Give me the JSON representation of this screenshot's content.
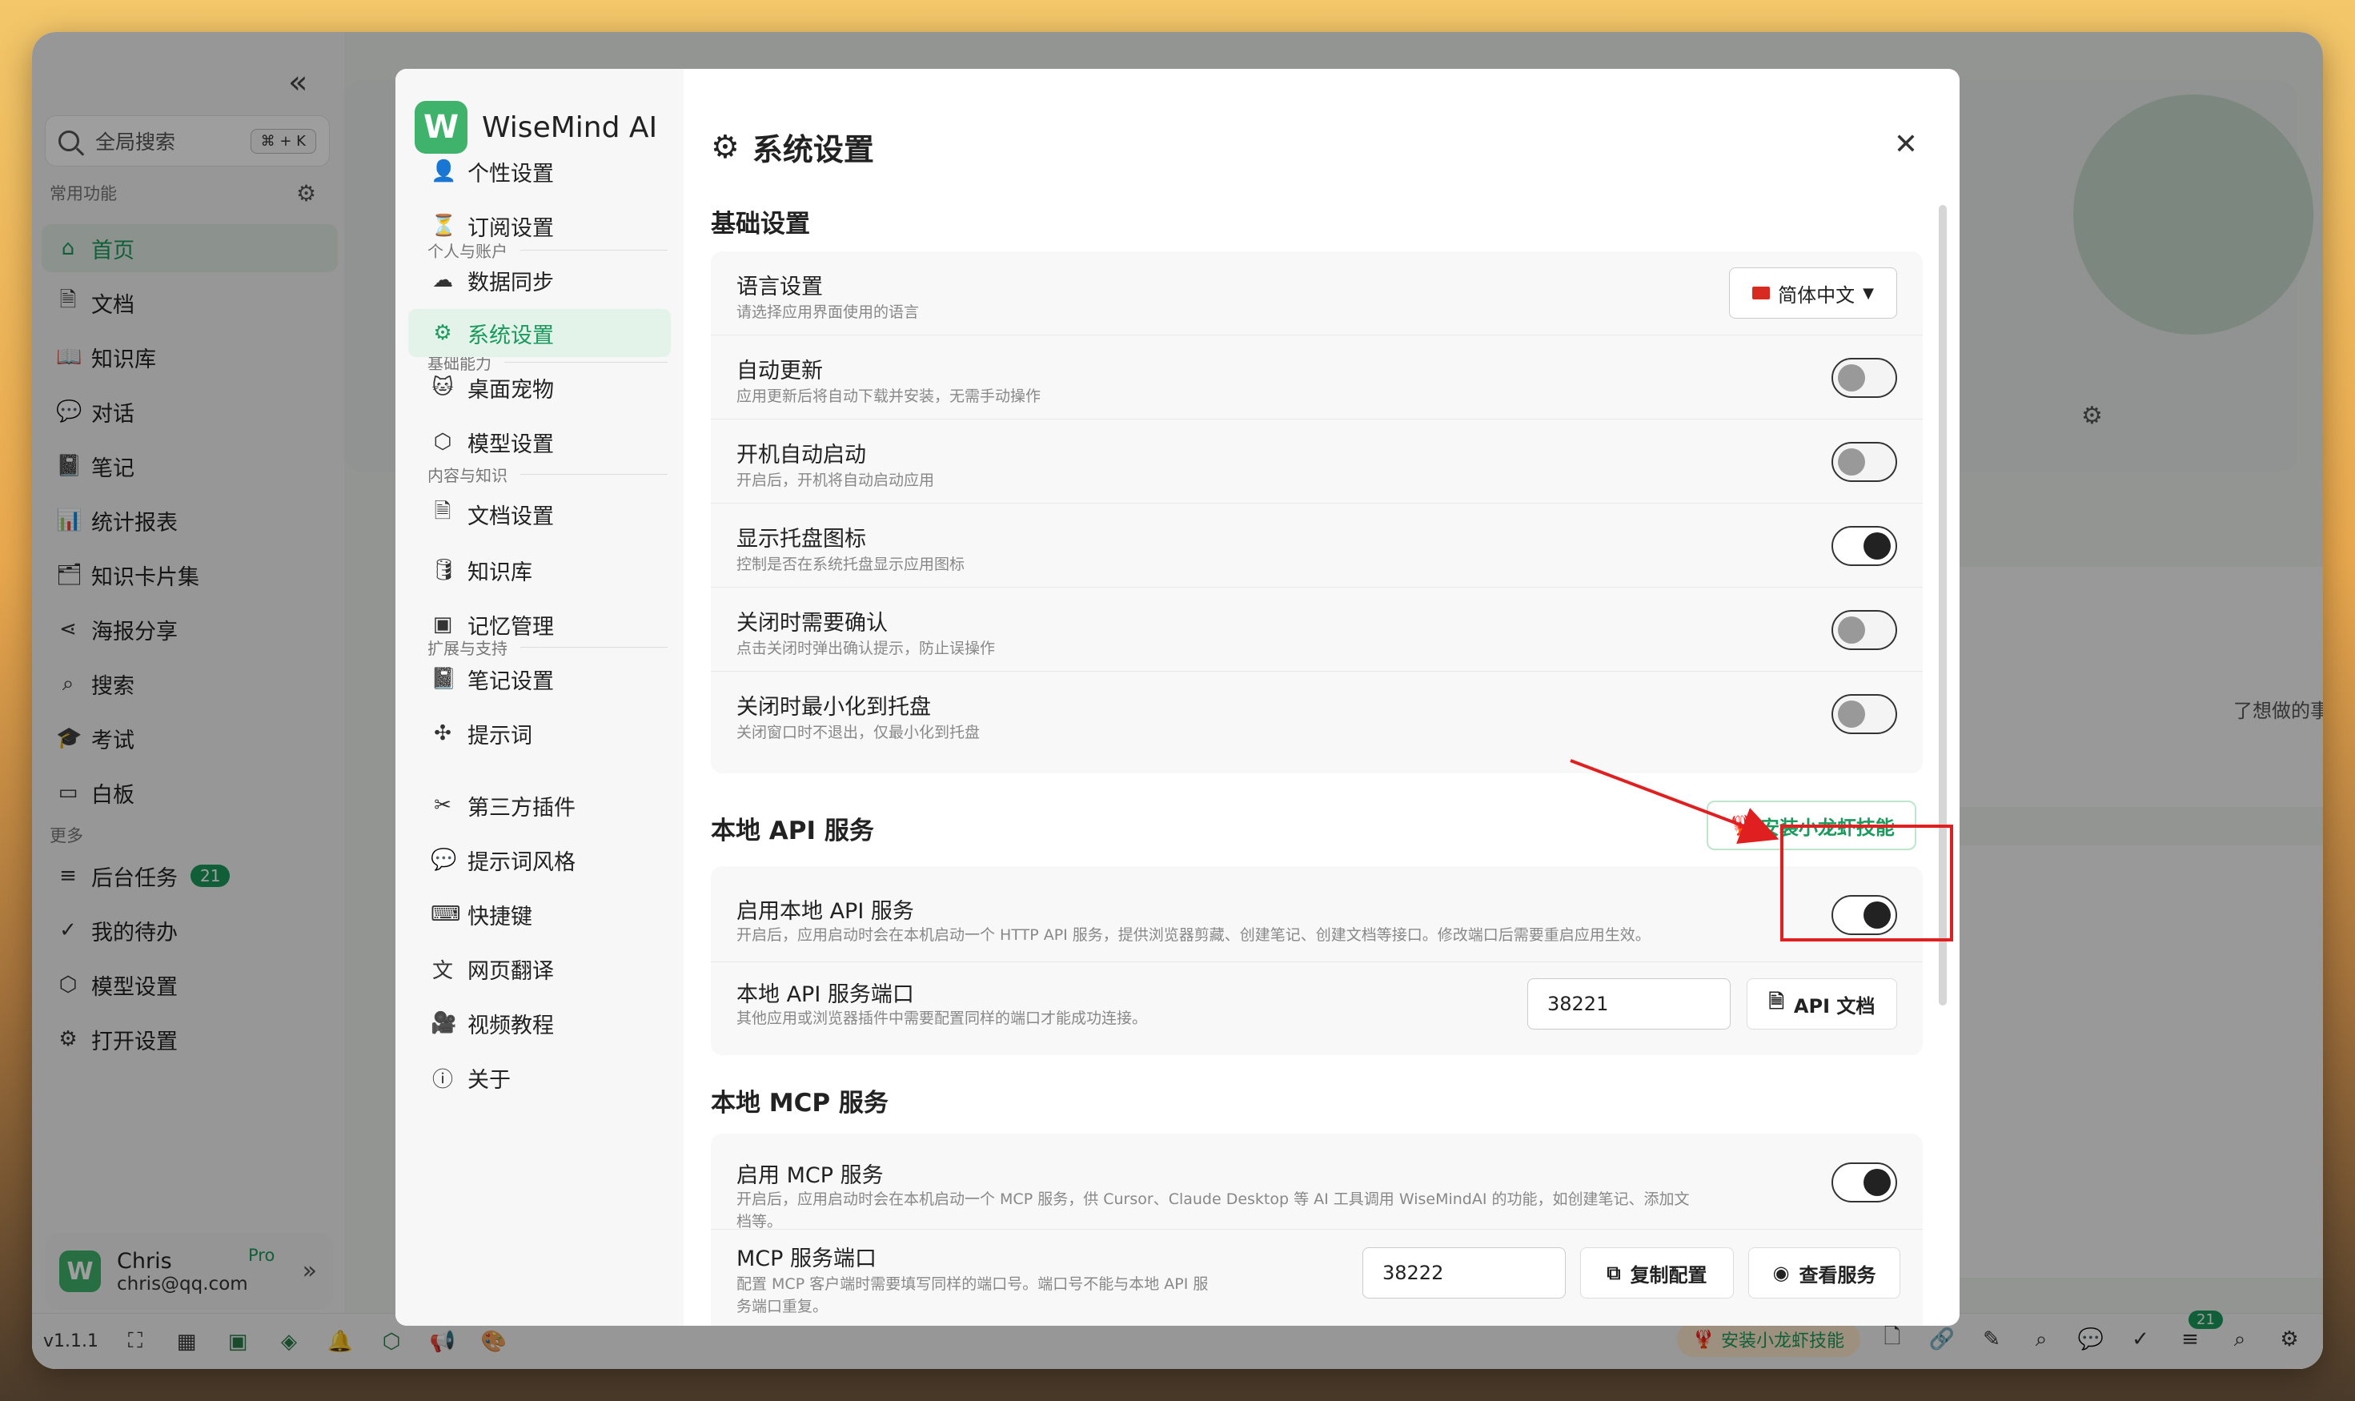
{
  "sidebar": {
    "search_placeholder": "全局搜索",
    "search_shortcut": "⌘ + K",
    "section_common": "常用功能",
    "section_more": "更多",
    "items": [
      {
        "label": "首页",
        "icon": "home-icon",
        "glyph": "⌂"
      },
      {
        "label": "文档",
        "icon": "document-icon",
        "glyph": "🗎"
      },
      {
        "label": "知识库",
        "icon": "book-icon",
        "glyph": "📖"
      },
      {
        "label": "对话",
        "icon": "chat-icon",
        "glyph": "💬"
      },
      {
        "label": "笔记",
        "icon": "notebook-icon",
        "glyph": "📓"
      },
      {
        "label": "统计报表",
        "icon": "chart-icon",
        "glyph": "📊"
      },
      {
        "label": "知识卡片集",
        "icon": "card-icon",
        "glyph": "🗂"
      },
      {
        "label": "海报分享",
        "icon": "share-icon",
        "glyph": "⋖"
      },
      {
        "label": "搜索",
        "icon": "search-icon",
        "glyph": "⌕"
      },
      {
        "label": "考试",
        "icon": "graduation-icon",
        "glyph": "🎓"
      },
      {
        "label": "白板",
        "icon": "whiteboard-icon",
        "glyph": "▭"
      }
    ],
    "more_items": [
      {
        "label": "后台任务",
        "icon": "list-icon",
        "glyph": "≡",
        "badge": "21"
      },
      {
        "label": "我的待办",
        "icon": "check-circle-icon",
        "glyph": "✓"
      },
      {
        "label": "模型设置",
        "icon": "cube-icon",
        "glyph": "⬡"
      },
      {
        "label": "打开设置",
        "icon": "gear-icon",
        "glyph": "⚙"
      }
    ],
    "user": {
      "name": "Chris",
      "email": "chris@qq.com",
      "plan": "Pro",
      "avatar": "W"
    }
  },
  "bottombar": {
    "version": "v1.1.1",
    "install_label": "安装小龙虾技能",
    "task_badge": "21"
  },
  "bg": {
    "text_fragment": "了想做的事，再扩"
  },
  "modal": {
    "logo_letter": "W",
    "app_name": "WiseMind AI",
    "title": "系统设置",
    "groups": [
      "个人与账户",
      "基础能力",
      "内容与知识",
      "扩展与支持"
    ],
    "nav": [
      {
        "label": "个性设置",
        "glyph": "👤",
        "icon": "user-icon"
      },
      {
        "label": "订阅设置",
        "glyph": "⏳",
        "icon": "hourglass-icon"
      },
      {
        "label": "数据同步",
        "glyph": "☁",
        "icon": "cloud-sync-icon"
      },
      {
        "label": "系统设置",
        "glyph": "⚙",
        "icon": "gear-icon"
      },
      {
        "label": "桌面宠物",
        "glyph": "🐱",
        "icon": "pet-icon"
      },
      {
        "label": "模型设置",
        "glyph": "⬡",
        "icon": "cube-icon"
      },
      {
        "label": "文档设置",
        "glyph": "🗎",
        "icon": "document-icon"
      },
      {
        "label": "知识库",
        "glyph": "🛢",
        "icon": "database-icon"
      },
      {
        "label": "记忆管理",
        "glyph": "▣",
        "icon": "chip-icon"
      },
      {
        "label": "笔记设置",
        "glyph": "📓",
        "icon": "notebook-icon"
      },
      {
        "label": "提示词",
        "glyph": "✣",
        "icon": "puzzle-icon"
      },
      {
        "label": "第三方插件",
        "glyph": "✂",
        "icon": "tools-icon"
      },
      {
        "label": "提示词风格",
        "glyph": "💬",
        "icon": "chat-icon"
      },
      {
        "label": "快捷键",
        "glyph": "⌨",
        "icon": "keyboard-icon"
      },
      {
        "label": "网页翻译",
        "glyph": "文",
        "icon": "translate-icon"
      },
      {
        "label": "视频教程",
        "glyph": "🎥",
        "icon": "video-icon"
      },
      {
        "label": "关于",
        "glyph": "ⓘ",
        "icon": "info-icon"
      }
    ],
    "basic": {
      "title": "基础设置",
      "rows": [
        {
          "title": "语言设置",
          "desc": "请选择应用界面使用的语言",
          "type": "select",
          "value": "简体中文"
        },
        {
          "title": "自动更新",
          "desc": "应用更新后将自动下载并安装，无需手动操作",
          "type": "toggle",
          "on": false
        },
        {
          "title": "开机自动启动",
          "desc": "开启后，开机将自动启动应用",
          "type": "toggle",
          "on": false
        },
        {
          "title": "显示托盘图标",
          "desc": "控制是否在系统托盘显示应用图标",
          "type": "toggle",
          "on": true
        },
        {
          "title": "关闭时需要确认",
          "desc": "点击关闭时弹出确认提示，防止误操作",
          "type": "toggle",
          "on": false
        },
        {
          "title": "关闭时最小化到托盘",
          "desc": "关闭窗口时不退出，仅最小化到托盘",
          "type": "toggle",
          "on": false
        }
      ]
    },
    "api": {
      "title": "本地 API 服务",
      "install_button": "安装小龙虾技能",
      "enable_title": "启用本地 API 服务",
      "enable_desc": "开启后，应用启动时会在本机启动一个 HTTP API 服务，提供浏览器剪藏、创建笔记、创建文档等接口。修改端口后需要重启应用生效。",
      "enable_on": true,
      "port_title": "本地 API 服务端口",
      "port_desc": "其他应用或浏览器插件中需要配置同样的端口才能成功连接。",
      "port_value": "38221",
      "docs_button": "API 文档"
    },
    "mcp": {
      "title": "本地 MCP 服务",
      "enable_title": "启用 MCP 服务",
      "enable_desc": "开启后，应用启动时会在本机启动一个 MCP 服务，供 Cursor、Claude Desktop 等 AI 工具调用 WiseMindAI 的功能，如创建笔记、添加文档等。",
      "enable_on": true,
      "port_title": "MCP 服务端口",
      "port_desc": "配置 MCP 客户端时需要填写同样的端口号。端口号不能与本地 API 服务端口重复。",
      "port_value": "38222",
      "copy_button": "复制配置",
      "view_button": "查看服务"
    }
  },
  "colors": {
    "accent": "#1a9a5c",
    "annotation": "#e02020"
  }
}
